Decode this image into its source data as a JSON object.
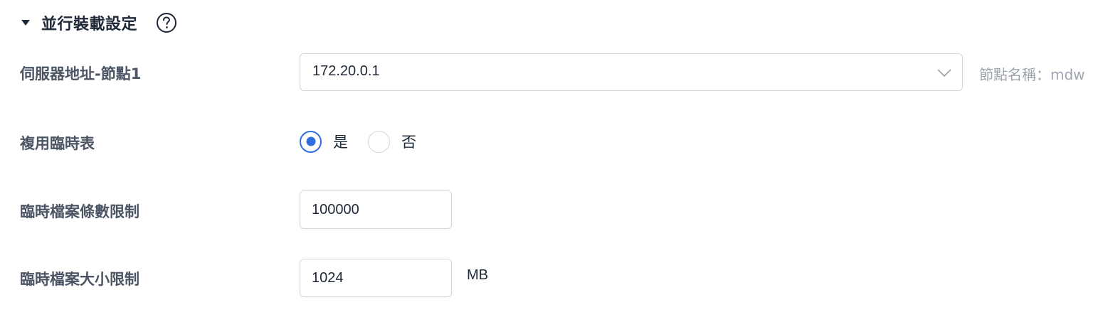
{
  "section": {
    "title": "並行裝載設定",
    "collapse_icon": "caret-down-icon",
    "help_icon": "question-circle-icon"
  },
  "server_address": {
    "label": "伺服器地址-節點1",
    "selected_value": "172.20.0.1",
    "dropdown_icon": "chevron-down-icon",
    "node_name_hint": "節點名稱：mdw"
  },
  "reuse_temp_table": {
    "label": "複用臨時表",
    "options": [
      {
        "label": "是",
        "selected": true
      },
      {
        "label": "否",
        "selected": false
      }
    ],
    "accent_color": "#2f6ee0"
  },
  "temp_file_row_limit": {
    "label": "臨時檔案條數限制",
    "value": "100000"
  },
  "temp_file_size_limit": {
    "label": "臨時檔案大小限制",
    "value": "1024",
    "unit": "MB"
  }
}
